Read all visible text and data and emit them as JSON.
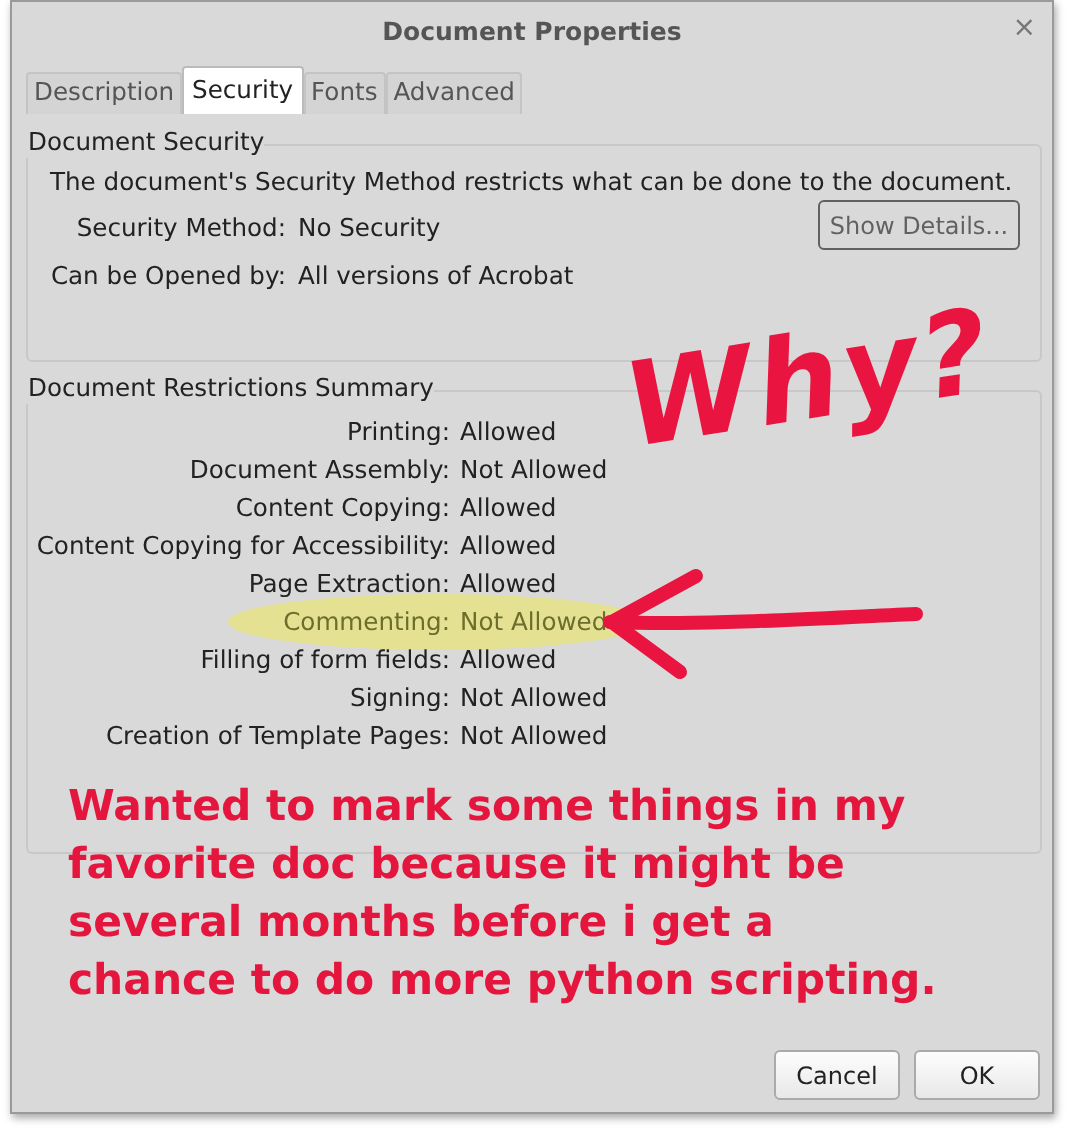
{
  "window": {
    "title": "Document Properties",
    "close": "×"
  },
  "tabs": [
    {
      "label": "Description",
      "selected": false
    },
    {
      "label": "Security",
      "selected": true
    },
    {
      "label": "Fonts",
      "selected": false
    },
    {
      "label": "Advanced",
      "selected": false
    }
  ],
  "document_security": {
    "title": "Document Security",
    "description": "The document's Security Method restricts what can be done to the document.",
    "fields": [
      {
        "label": "Security Method:",
        "value": "No Security"
      },
      {
        "label": "Can be Opened by:",
        "value": "All versions of Acrobat"
      }
    ],
    "show_details_button": {
      "label": "Show Details...",
      "disabled": true
    }
  },
  "restrictions": {
    "title": "Document Restrictions Summary",
    "rows": [
      {
        "label": "Printing:",
        "value": "Allowed",
        "highlighted": false
      },
      {
        "label": "Document Assembly:",
        "value": "Not Allowed",
        "highlighted": false
      },
      {
        "label": "Content Copying:",
        "value": "Allowed",
        "highlighted": false
      },
      {
        "label": "Content Copying for Accessibility:",
        "value": "Allowed",
        "highlighted": false
      },
      {
        "label": "Page Extraction:",
        "value": "Allowed",
        "highlighted": false
      },
      {
        "label": "Commenting:",
        "value": "Not Allowed",
        "highlighted": true
      },
      {
        "label": "Filling of form fields:",
        "value": "Allowed",
        "highlighted": false
      },
      {
        "label": "Signing:",
        "value": "Not Allowed",
        "highlighted": false
      },
      {
        "label": "Creation of Template Pages:",
        "value": "Not Allowed",
        "highlighted": false
      }
    ]
  },
  "annotations": {
    "handwritten": "Why?",
    "note_lines": [
      "Wanted to mark some things in my",
      "favorite doc because it might be",
      "several months before i get a",
      "chance to do more python scripting."
    ]
  },
  "buttons": [
    "Cancel",
    "OK"
  ]
}
